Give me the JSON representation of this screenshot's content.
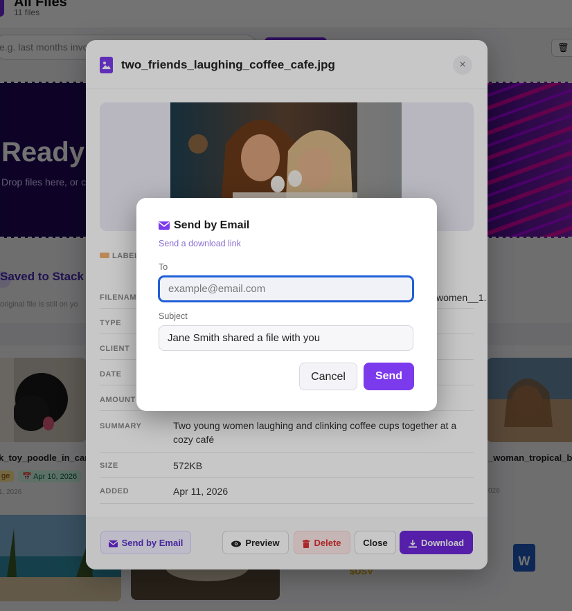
{
  "background": {
    "title": "All Files",
    "file_count": "11 files",
    "search_placeholder": "e.g. last months invoices",
    "hero_title": "Ready t",
    "hero_sub": "Drop files here, or cl",
    "stack_title": "Saved to Stack",
    "stack_sub": "original file is still on yo",
    "cards": [
      {
        "name": "k_toy_poodle_in_car",
        "tag1": "ge",
        "tag2": "📅 Apr 10, 2026",
        "date": "1, 2026"
      },
      {
        "name": "_woman_tropical_be",
        "date": "026"
      }
    ],
    "trash_label": "🗑 S",
    "word_icon": "W",
    "partial_text": "$USV"
  },
  "file_modal": {
    "title": "two_friends_laughing_coffee_cafe.jpg",
    "close_icon": "×",
    "labels_heading": "LABELS",
    "rows": [
      {
        "label": "FILENAME",
        "value": "women__1."
      },
      {
        "label": "TYPE",
        "value": ""
      },
      {
        "label": "CLIENT",
        "value": ""
      },
      {
        "label": "DATE",
        "value": ""
      },
      {
        "label": "AMOUNT",
        "value": ""
      },
      {
        "label": "SUMMARY",
        "value": "Two young women laughing and clinking coffee cups together at a cozy café"
      },
      {
        "label": "SIZE",
        "value": "572KB"
      },
      {
        "label": "ADDED",
        "value": "Apr 11, 2026"
      }
    ],
    "buttons": {
      "send_email": "Send by Email",
      "preview": "Preview",
      "delete": "Delete",
      "close": "Close",
      "download": "Download"
    }
  },
  "email_dialog": {
    "title": "Send by Email",
    "subtitle": "Send a download link",
    "to_label": "To",
    "to_placeholder": "example@email.com",
    "to_value": "",
    "subject_label": "Subject",
    "subject_value": "Jane Smith shared a file with you",
    "cancel": "Cancel",
    "send": "Send"
  },
  "colors": {
    "accent": "#7c3aed",
    "focus": "#1f5fd8",
    "danger": "#dd3333"
  }
}
